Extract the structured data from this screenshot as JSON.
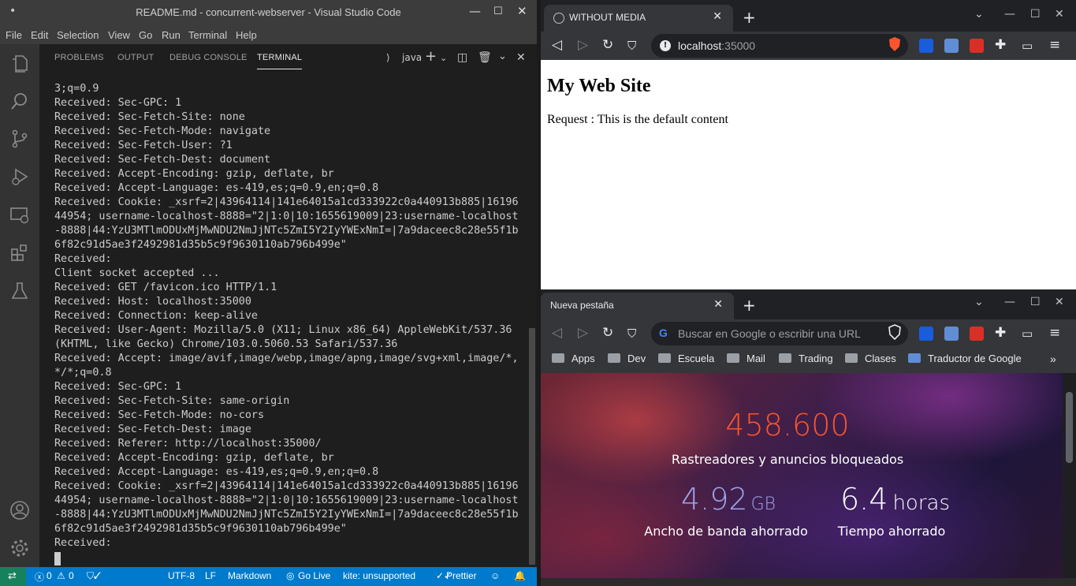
{
  "vscode": {
    "window_title": "README.md - concurrent-webserver - Visual Studio Code",
    "menu": [
      "File",
      "Edit",
      "Selection",
      "View",
      "Go",
      "Run",
      "Terminal",
      "Help"
    ],
    "panel_tabs": [
      "PROBLEMS",
      "OUTPUT",
      "DEBUG CONSOLE",
      "TERMINAL"
    ],
    "terminal_name": "java",
    "terminal_lines": [
      "3;q=0.9",
      "Received: Sec-GPC: 1",
      "Received: Sec-Fetch-Site: none",
      "Received: Sec-Fetch-Mode: navigate",
      "Received: Sec-Fetch-User: ?1",
      "Received: Sec-Fetch-Dest: document",
      "Received: Accept-Encoding: gzip, deflate, br",
      "Received: Accept-Language: es-419,es;q=0.9,en;q=0.8",
      "Received: Cookie: _xsrf=2|43964114|141e64015a1cd333922c0a440913b885|16196",
      "44954; username-localhost-8888=\"2|1:0|10:1655619009|23:username-localhost",
      "-8888|44:YzU3MTlmODUxMjMwNDU2NmJjNTc5ZmI5Y2IyYWExNmI=|7a9daceec8c28e55f1b",
      "6f82c91d5ae3f2492981d35b5c9f9630110ab796b499e\"",
      "Received:",
      "Client socket accepted ...",
      "Received: GET /favicon.ico HTTP/1.1",
      "Received: Host: localhost:35000",
      "Received: Connection: keep-alive",
      "Received: User-Agent: Mozilla/5.0 (X11; Linux x86_64) AppleWebKit/537.36",
      "(KHTML, like Gecko) Chrome/103.0.5060.53 Safari/537.36",
      "Received: Accept: image/avif,image/webp,image/apng,image/svg+xml,image/*,",
      "*/*;q=0.8",
      "Received: Sec-GPC: 1",
      "Received: Sec-Fetch-Site: same-origin",
      "Received: Sec-Fetch-Mode: no-cors",
      "Received: Sec-Fetch-Dest: image",
      "Received: Referer: http://localhost:35000/",
      "Received: Accept-Encoding: gzip, deflate, br",
      "Received: Accept-Language: es-419,es;q=0.9,en;q=0.8",
      "Received: Cookie: _xsrf=2|43964114|141e64015a1cd333922c0a440913b885|16196",
      "44954; username-localhost-8888=\"2|1:0|10:1655619009|23:username-localhost",
      "-8888|44:YzU3MTlmODUxMjMwNDU2NmJjNTc5ZmI5Y2IyYWExNmI=|7a9daceec8c28e55f1b",
      "6f82c91d5ae3f2492981d35b5c9f9630110ab796b499e\"",
      "Received:"
    ],
    "status": {
      "errors": "0",
      "warnings": "0",
      "encoding": "UTF-8",
      "eol": "LF",
      "language": "Markdown",
      "golive": "Go Live",
      "kite": "kite: unsupported",
      "prettier": "Prettier"
    },
    "colors": {
      "statusbar": "#007acc",
      "remote": "#16825d",
      "titlebar": "#3c3c3c",
      "activity": "#333333"
    }
  },
  "browser1": {
    "tab_title": "WITHOUT MEDIA",
    "url_host": "localhost",
    "url_port": ":35000",
    "page_heading": "My Web Site",
    "page_text": "Request : This is the default content"
  },
  "browser2": {
    "tab_title": "Nueva pestaña",
    "omnibox_placeholder": "Buscar en Google o escribir una URL",
    "bookmarks": [
      "Apps",
      "Dev",
      "Escuela",
      "Mail",
      "Trading",
      "Clases",
      "Traductor de Google"
    ],
    "stats": {
      "trackers_value": "458.600",
      "trackers_label": "Rastreadores y anuncios bloqueados",
      "bandwidth_value": "4.92",
      "bandwidth_unit": "GB",
      "bandwidth_label": "Ancho de banda ahorrado",
      "time_value": "6.4",
      "time_unit": "horas",
      "time_label": "Tiempo ahorrado"
    },
    "colors": {
      "trackers": "#fb542b",
      "bandwidth": "#a0a5eb",
      "time": "#ffffff"
    }
  }
}
